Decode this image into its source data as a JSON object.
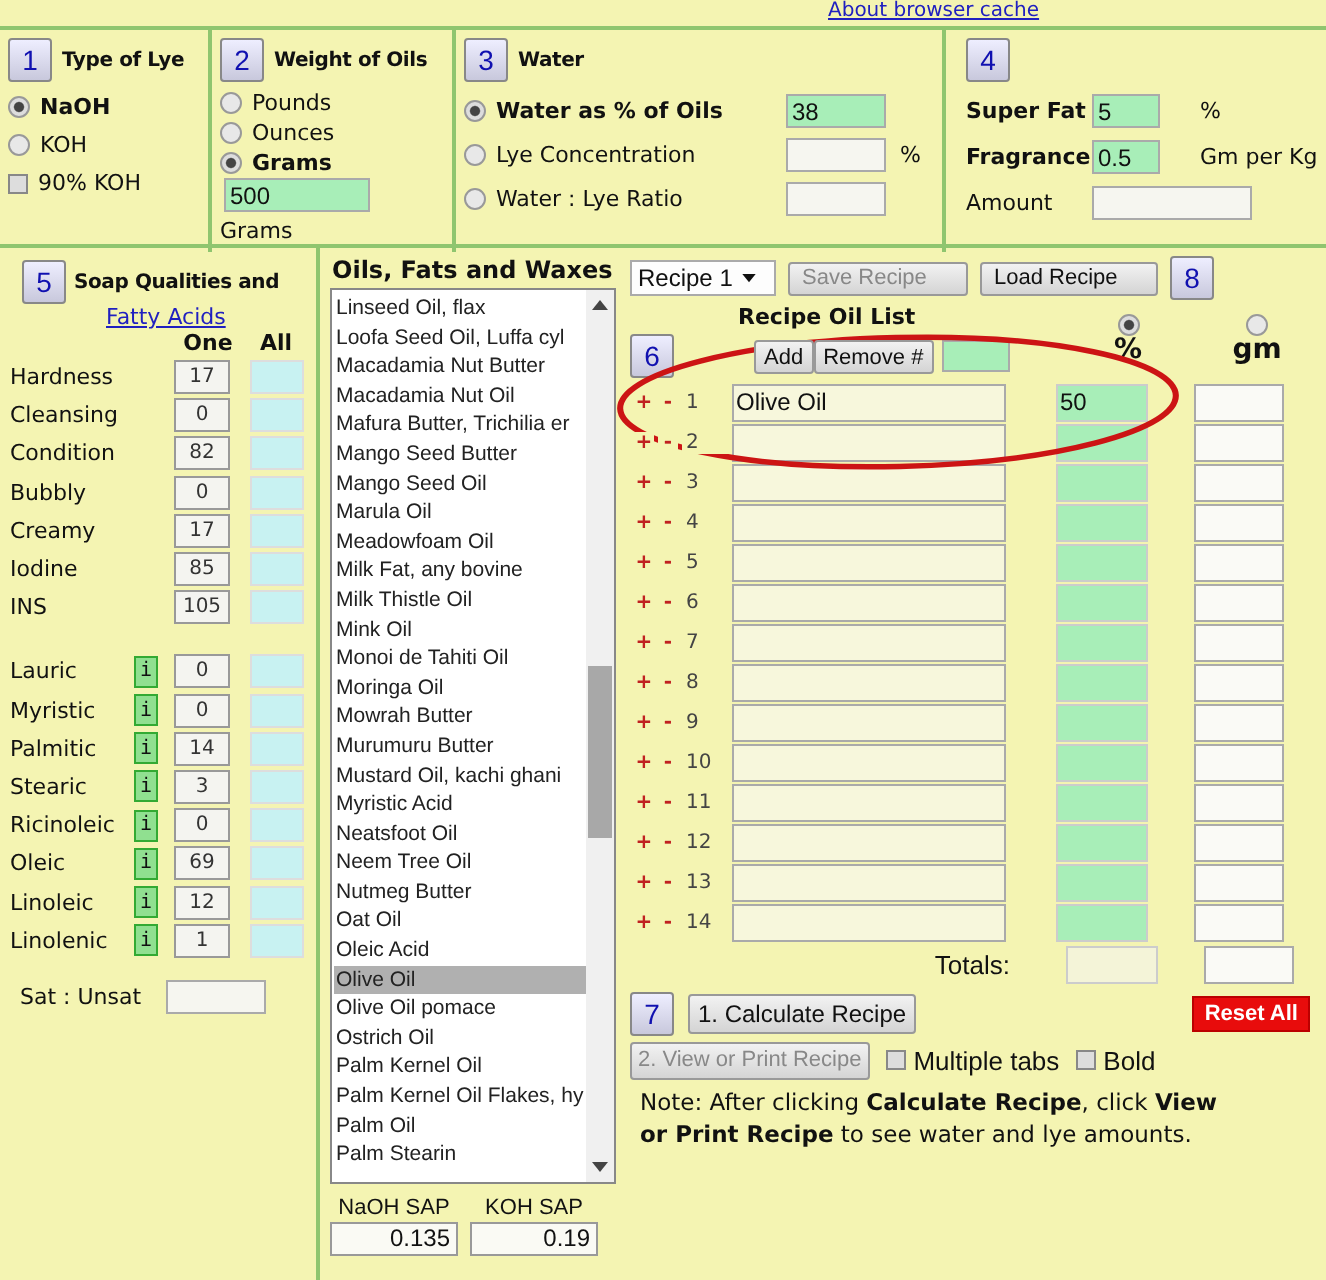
{
  "header_link": "About browser cache",
  "lye": {
    "number": "1",
    "title": "Type of Lye",
    "options": [
      {
        "label": "NaOH",
        "selected": true
      },
      {
        "label": "KOH",
        "selected": false
      }
    ],
    "koh90": {
      "label": "90% KOH",
      "checked": false
    }
  },
  "weight": {
    "number": "2",
    "title": "Weight of Oils",
    "options": [
      {
        "label": "Pounds",
        "selected": false
      },
      {
        "label": "Ounces",
        "selected": false
      },
      {
        "label": "Grams",
        "selected": true
      }
    ],
    "value": "500",
    "unit": "Grams"
  },
  "water": {
    "number": "3",
    "title": "Water",
    "options": [
      {
        "label": "Water as % of Oils",
        "selected": true,
        "value": "38"
      },
      {
        "label": "Lye Concentration",
        "selected": false,
        "unit": "%"
      },
      {
        "label": "Water : Lye Ratio",
        "selected": false
      }
    ]
  },
  "extras": {
    "number": "4",
    "fields": [
      {
        "label": "Super Fat",
        "kind": "input",
        "value": "5",
        "unit": "%"
      },
      {
        "label": "Fragrance",
        "kind": "input",
        "value": "0.5",
        "unit": "Gm per Kg"
      },
      {
        "label": "Amount",
        "kind": "result"
      }
    ]
  },
  "qualities": {
    "number": "5",
    "title": "Soap Qualities and",
    "link": "Fatty Acids",
    "col_one": "One",
    "col_all": "All",
    "rows": [
      {
        "label": "Hardness",
        "one": "17"
      },
      {
        "label": "Cleansing",
        "one": "0"
      },
      {
        "label": "Condition",
        "one": "82"
      },
      {
        "label": "Bubbly",
        "one": "0"
      },
      {
        "label": "Creamy",
        "one": "17"
      },
      {
        "label": "Iodine",
        "one": "85"
      },
      {
        "label": "INS",
        "one": "105"
      }
    ],
    "fatty_acids": [
      {
        "label": "Lauric",
        "info": "i",
        "one": "0"
      },
      {
        "label": "Myristic",
        "info": "i",
        "one": "0"
      },
      {
        "label": "Palmitic",
        "info": "i",
        "one": "14"
      },
      {
        "label": "Stearic",
        "info": "i",
        "one": "3"
      },
      {
        "label": "Ricinoleic",
        "info": "i",
        "one": "0"
      },
      {
        "label": "Oleic",
        "info": "i",
        "one": "69"
      },
      {
        "label": "Linoleic",
        "info": "i",
        "one": "12"
      },
      {
        "label": "Linolenic",
        "info": "i",
        "one": "1"
      }
    ],
    "ratio_label": "Sat : Unsat"
  },
  "oils": {
    "title": "Oils, Fats and Waxes",
    "items": [
      {
        "label": "Linseed Oil, flax",
        "selected": false
      },
      {
        "label": "Loofa Seed Oil, Luffa cyl",
        "selected": false
      },
      {
        "label": "Macadamia Nut Butter",
        "selected": false
      },
      {
        "label": "Macadamia Nut Oil",
        "selected": false
      },
      {
        "label": "Mafura Butter, Trichilia er",
        "selected": false
      },
      {
        "label": "Mango Seed Butter",
        "selected": false
      },
      {
        "label": "Mango Seed Oil",
        "selected": false
      },
      {
        "label": "Marula Oil",
        "selected": false
      },
      {
        "label": "Meadowfoam Oil",
        "selected": false
      },
      {
        "label": "Milk Fat, any bovine",
        "selected": false
      },
      {
        "label": "Milk Thistle Oil",
        "selected": false
      },
      {
        "label": "Mink Oil",
        "selected": false
      },
      {
        "label": "Monoi de Tahiti Oil",
        "selected": false
      },
      {
        "label": "Moringa Oil",
        "selected": false
      },
      {
        "label": "Mowrah Butter",
        "selected": false
      },
      {
        "label": "Murumuru Butter",
        "selected": false
      },
      {
        "label": "Mustard Oil, kachi ghani",
        "selected": false
      },
      {
        "label": "Myristic Acid",
        "selected": false
      },
      {
        "label": "Neatsfoot Oil",
        "selected": false
      },
      {
        "label": "Neem Tree Oil",
        "selected": false
      },
      {
        "label": "Nutmeg Butter",
        "selected": false
      },
      {
        "label": "Oat Oil",
        "selected": false
      },
      {
        "label": "Oleic Acid",
        "selected": false
      },
      {
        "label": "Olive Oil",
        "selected": true
      },
      {
        "label": "Olive Oil pomace",
        "selected": false
      },
      {
        "label": "Ostrich Oil",
        "selected": false
      },
      {
        "label": "Palm Kernel Oil",
        "selected": false
      },
      {
        "label": "Palm Kernel Oil Flakes, hy",
        "selected": false
      },
      {
        "label": "Palm Oil",
        "selected": false
      },
      {
        "label": "Palm Stearin",
        "selected": false
      }
    ],
    "sap": [
      {
        "label": "NaOH SAP",
        "value": "0.135"
      },
      {
        "label": "KOH SAP",
        "value": "0.19"
      }
    ]
  },
  "recipe": {
    "select": "Recipe 1",
    "save": {
      "label": "Save Recipe",
      "disabled": true
    },
    "load": "Load Recipe",
    "help_number": "8",
    "title": "Recipe Oil List",
    "number": "6",
    "add": "Add",
    "remove": "Remove #",
    "percent_col": {
      "label": "%",
      "selected": true
    },
    "gm_col": {
      "label": "gm",
      "selected": false
    },
    "rows": [
      {
        "plus": "+",
        "minus": "-",
        "num": "1",
        "name": "Olive Oil",
        "percent": "50"
      },
      {
        "plus": "+",
        "minus": "-",
        "num": "2"
      },
      {
        "plus": "+",
        "minus": "-",
        "num": "3"
      },
      {
        "plus": "+",
        "minus": "-",
        "num": "4"
      },
      {
        "plus": "+",
        "minus": "-",
        "num": "5"
      },
      {
        "plus": "+",
        "minus": "-",
        "num": "6"
      },
      {
        "plus": "+",
        "minus": "-",
        "num": "7"
      },
      {
        "plus": "+",
        "minus": "-",
        "num": "8"
      },
      {
        "plus": "+",
        "minus": "-",
        "num": "9"
      },
      {
        "plus": "+",
        "minus": "-",
        "num": "10"
      },
      {
        "plus": "+",
        "minus": "-",
        "num": "11"
      },
      {
        "plus": "+",
        "minus": "-",
        "num": "12"
      },
      {
        "plus": "+",
        "minus": "-",
        "num": "13"
      },
      {
        "plus": "+",
        "minus": "-",
        "num": "14"
      }
    ],
    "totals": "Totals:"
  },
  "actions": {
    "number": "7",
    "calculate": "1. Calculate Recipe",
    "view": {
      "label": "2. View or Print Recipe",
      "disabled": true
    },
    "reset": "Reset All",
    "checks": [
      {
        "label": "Multiple tabs",
        "checked": false
      },
      {
        "label": "Bold",
        "checked": false
      }
    ],
    "note": "Note: After clicking **Calculate Recipe**, click **View or Print Recipe** to see water and lye amounts."
  }
}
